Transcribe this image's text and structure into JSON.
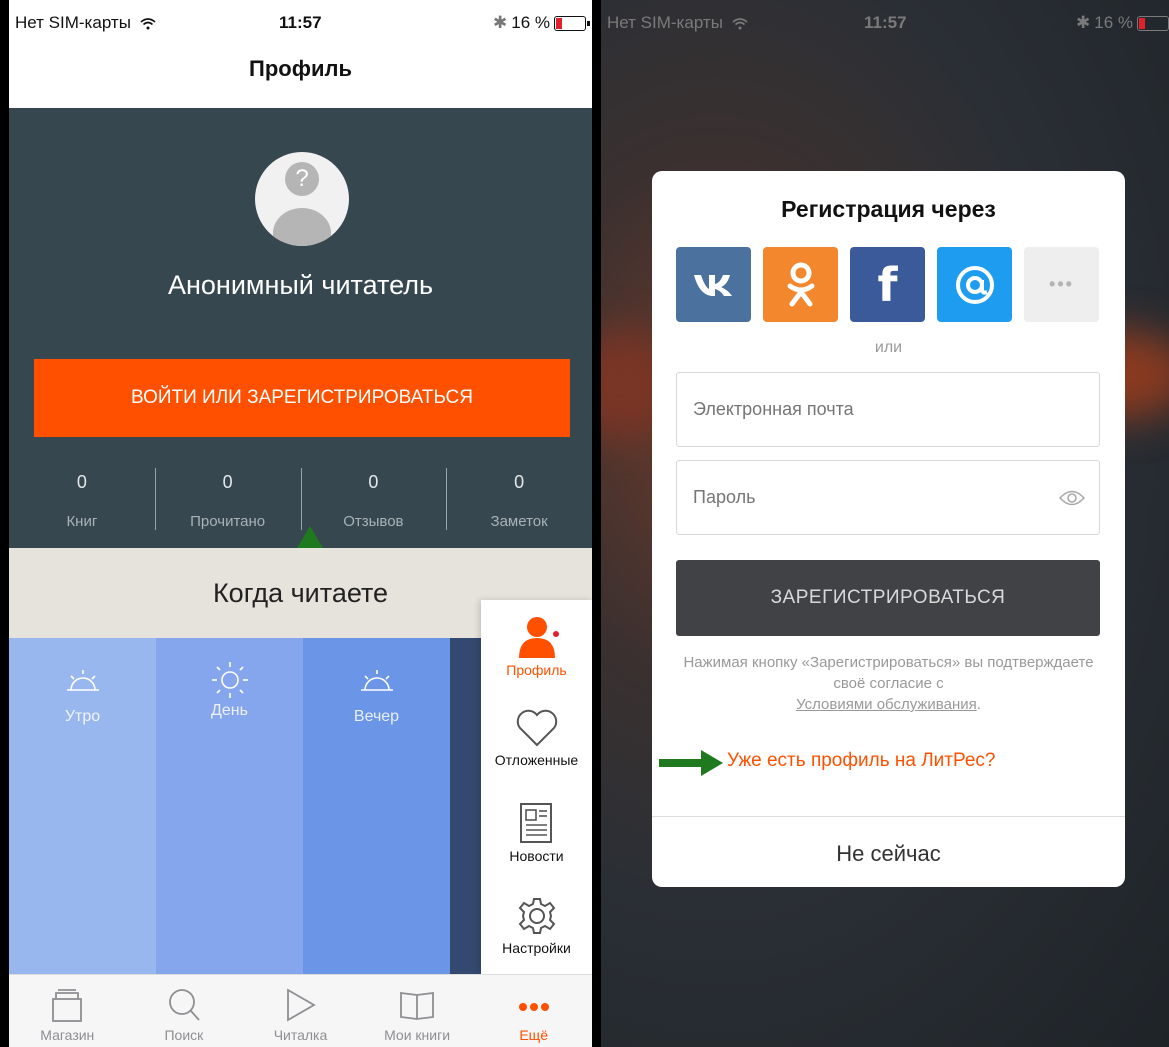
{
  "left": {
    "status": {
      "carrier": "Нет SIM-карты",
      "time": "11:57",
      "battery": "16 %"
    },
    "title": "Профиль",
    "profile": {
      "avatar_glyph": "?",
      "name": "Анонимный читатель",
      "login_button": "ВОЙТИ ИЛИ ЗАРЕГИСТРИРОВАТЬСЯ",
      "stats": [
        {
          "value": "0",
          "label": "Книг"
        },
        {
          "value": "0",
          "label": "Прочитано"
        },
        {
          "value": "0",
          "label": "Отзывов"
        },
        {
          "value": "0",
          "label": "Заметок"
        }
      ]
    },
    "when_reading": {
      "title": "Когда читаете",
      "periods": [
        {
          "label": "Утро",
          "icon": "sunrise-icon"
        },
        {
          "label": "День",
          "icon": "sun-icon"
        },
        {
          "label": "Вечер",
          "icon": "sunset-icon"
        }
      ]
    },
    "more_menu": [
      {
        "label": "Профиль",
        "icon": "person-icon",
        "active": true
      },
      {
        "label": "Отложенные",
        "icon": "heart-icon"
      },
      {
        "label": "Новости",
        "icon": "newspaper-icon"
      },
      {
        "label": "Настройки",
        "icon": "gear-icon"
      }
    ],
    "tabbar": [
      {
        "label": "Магазин",
        "icon": "store-icon"
      },
      {
        "label": "Поиск",
        "icon": "search-icon"
      },
      {
        "label": "Читалка",
        "icon": "play-icon"
      },
      {
        "label": "Мои книги",
        "icon": "book-icon"
      },
      {
        "label": "Ещё",
        "icon": "more-dots-icon",
        "active": true
      }
    ],
    "accent_color": "#ff5000",
    "annotation_color": "#1f7a1f"
  },
  "right": {
    "status": {
      "carrier": "Нет SIM-карты",
      "time": "11:57",
      "battery": "16 %"
    },
    "modal": {
      "title": "Регистрация через",
      "social": [
        {
          "name": "vk",
          "glyph": "vk"
        },
        {
          "name": "odnoklassniki",
          "glyph": "ok"
        },
        {
          "name": "facebook",
          "glyph": "f"
        },
        {
          "name": "mailru",
          "glyph": "@"
        },
        {
          "name": "more",
          "glyph": "•••"
        }
      ],
      "or": "или",
      "email_placeholder": "Электронная почта",
      "password_placeholder": "Пароль",
      "register_button": "ЗАРЕГИСТРИРОВАТЬСЯ",
      "terms_text": "Нажимая кнопку «Зарегистрироваться» вы подтверждаете своё согласие с",
      "terms_link": "Условиями обслуживания",
      "terms_end": ".",
      "existing_account": "Уже есть профиль на ЛитРес?",
      "not_now": "Не сейчас"
    }
  }
}
